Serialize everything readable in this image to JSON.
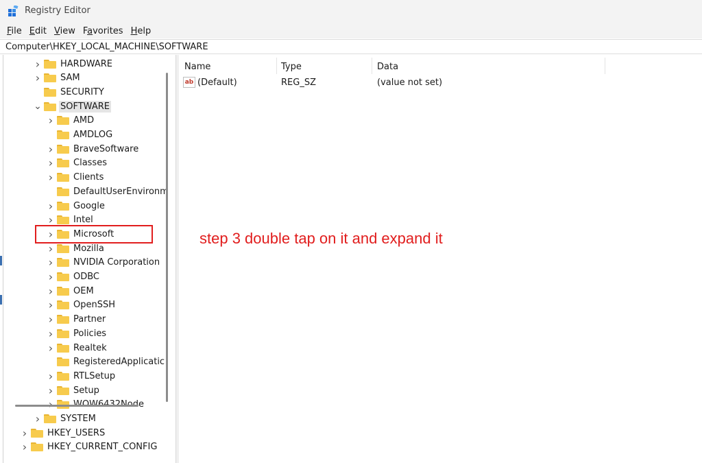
{
  "window": {
    "title": "Registry Editor"
  },
  "menu": [
    {
      "label": "File",
      "accel": "F",
      "rest": "ile"
    },
    {
      "label": "Edit",
      "accel": "E",
      "rest": "dit"
    },
    {
      "label": "View",
      "accel": "V",
      "rest": "iew"
    },
    {
      "label": "Favorites",
      "accel": "a",
      "pre": "F",
      "rest": "vorites"
    },
    {
      "label": "Help",
      "accel": "H",
      "rest": "elp"
    }
  ],
  "address": "Computer\\HKEY_LOCAL_MACHINE\\SOFTWARE",
  "tree": [
    {
      "label": "HARDWARE",
      "level": 2,
      "expander": "collapsed"
    },
    {
      "label": "SAM",
      "level": 2,
      "expander": "collapsed"
    },
    {
      "label": "SECURITY",
      "level": 2,
      "expander": "none"
    },
    {
      "label": "SOFTWARE",
      "level": 2,
      "expander": "expanded",
      "selected": true
    },
    {
      "label": "AMD",
      "level": 3,
      "expander": "collapsed"
    },
    {
      "label": "AMDLOG",
      "level": 3,
      "expander": "none"
    },
    {
      "label": "BraveSoftware",
      "level": 3,
      "expander": "collapsed"
    },
    {
      "label": "Classes",
      "level": 3,
      "expander": "collapsed"
    },
    {
      "label": "Clients",
      "level": 3,
      "expander": "collapsed"
    },
    {
      "label": "DefaultUserEnvironm",
      "level": 3,
      "expander": "none"
    },
    {
      "label": "Google",
      "level": 3,
      "expander": "collapsed"
    },
    {
      "label": "Intel",
      "level": 3,
      "expander": "collapsed"
    },
    {
      "label": "Microsoft",
      "level": 3,
      "expander": "collapsed"
    },
    {
      "label": "Mozilla",
      "level": 3,
      "expander": "collapsed"
    },
    {
      "label": "NVIDIA Corporation",
      "level": 3,
      "expander": "collapsed"
    },
    {
      "label": "ODBC",
      "level": 3,
      "expander": "collapsed"
    },
    {
      "label": "OEM",
      "level": 3,
      "expander": "collapsed"
    },
    {
      "label": "OpenSSH",
      "level": 3,
      "expander": "collapsed"
    },
    {
      "label": "Partner",
      "level": 3,
      "expander": "collapsed"
    },
    {
      "label": "Policies",
      "level": 3,
      "expander": "collapsed"
    },
    {
      "label": "Realtek",
      "level": 3,
      "expander": "collapsed"
    },
    {
      "label": "RegisteredApplicatic",
      "level": 3,
      "expander": "none"
    },
    {
      "label": "RTLSetup",
      "level": 3,
      "expander": "collapsed"
    },
    {
      "label": "Setup",
      "level": 3,
      "expander": "collapsed"
    },
    {
      "label": "WOW6432Node",
      "level": 3,
      "expander": "collapsed"
    },
    {
      "label": "SYSTEM",
      "level": 2,
      "expander": "collapsed"
    },
    {
      "label": "HKEY_USERS",
      "level": 1,
      "expander": "collapsed"
    },
    {
      "label": "HKEY_CURRENT_CONFIG",
      "level": 1,
      "expander": "collapsed"
    }
  ],
  "list": {
    "columns": [
      "Name",
      "Type",
      "Data"
    ],
    "rows": [
      {
        "icon": "string-value-icon",
        "icon_text": "ab",
        "name": "(Default)",
        "type": "REG_SZ",
        "data": "(value not set)"
      }
    ]
  },
  "annotation": {
    "text": "step 3 double tap on it and expand it",
    "color": "#e11d1d"
  }
}
